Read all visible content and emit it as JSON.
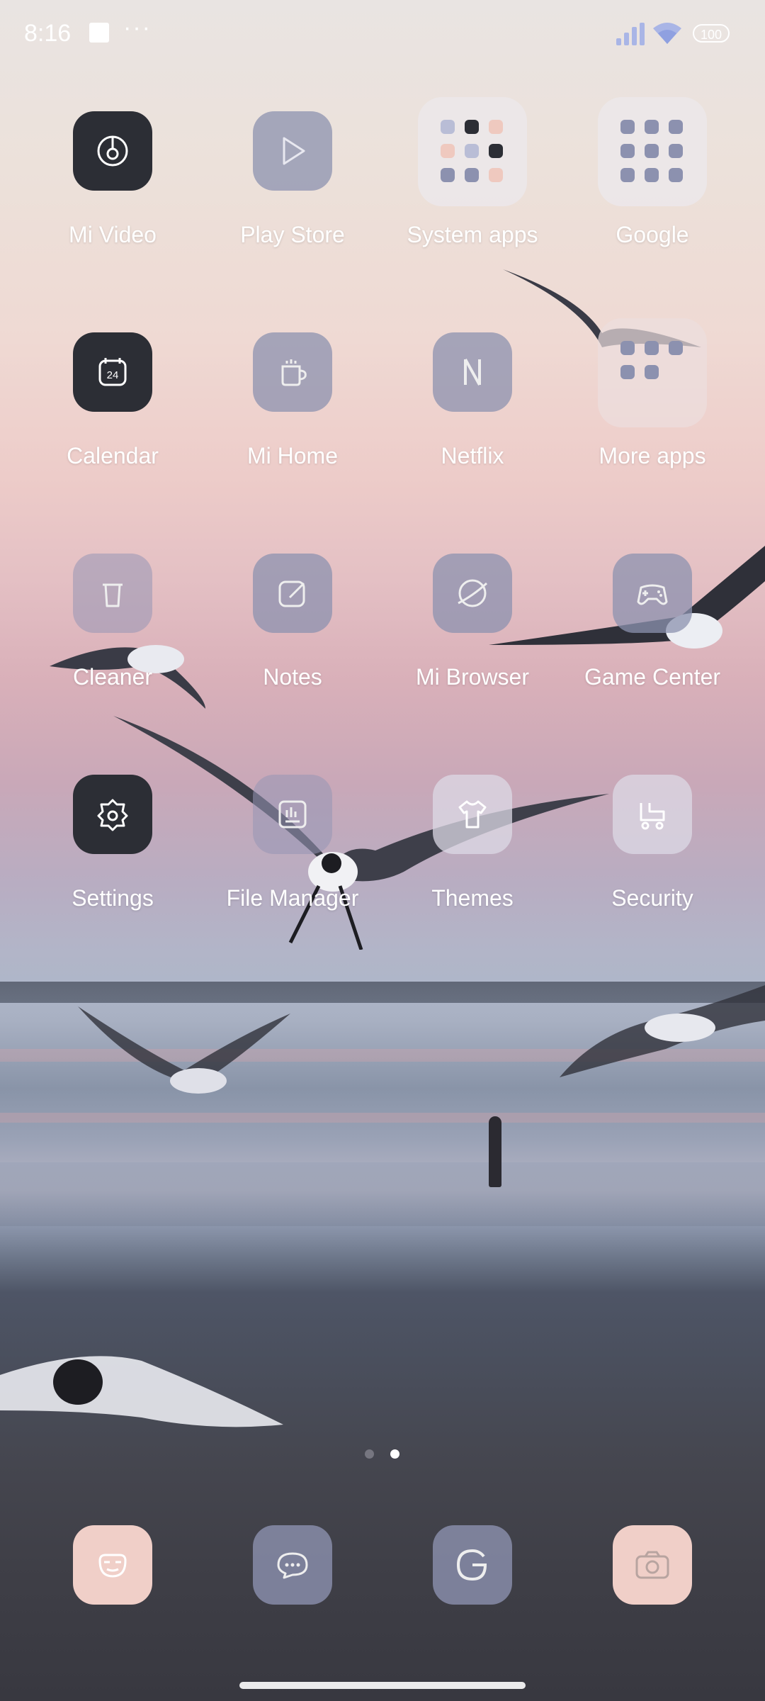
{
  "status_bar": {
    "time": "8:16",
    "more": "···",
    "battery": "100"
  },
  "apps": {
    "mi_video": "Mi Video",
    "play_store": "Play Store",
    "system_apps": "System apps",
    "google": "Google",
    "calendar": "Calendar",
    "calendar_day": "24",
    "mi_home": "Mi Home",
    "netflix": "Netflix",
    "more_apps": "More apps",
    "cleaner": "Cleaner",
    "notes": "Notes",
    "mi_browser": "Mi Browser",
    "game_center": "Game Center",
    "settings": "Settings",
    "file_manager": "File Manager",
    "themes": "Themes",
    "security": "Security"
  },
  "page_indicator": {
    "pages": 2,
    "current": 2
  },
  "dock": [
    "contacts",
    "messages",
    "google-search",
    "camera"
  ],
  "colors": {
    "dark_icon": "#2c2e35",
    "glass_icon": "#8c91af",
    "dock_pink": "#f0cfc8",
    "signal_bars": "#a9b5e6"
  }
}
